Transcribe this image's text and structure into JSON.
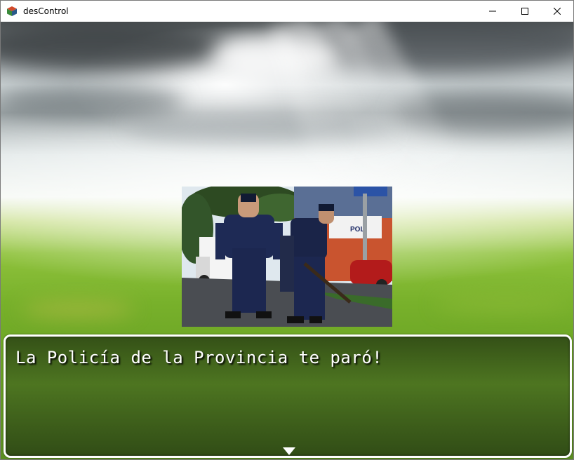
{
  "window": {
    "title": "desControl",
    "icon": "app-cube-icon",
    "controls": [
      "minimize-icon",
      "maximize-icon",
      "close-icon"
    ]
  },
  "scene": {
    "background": "cloudy sky over green grass field",
    "picture": "police officers standing in a street in front of a police station"
  },
  "dialog": {
    "message": "La Policía de la Provincia te paró!",
    "continue_indicator": "down-triangle-icon"
  },
  "colors": {
    "dialog_border": "#ffffff",
    "text": "#ffffff",
    "grass": "#78b12b",
    "uniform": "#1e2a55"
  }
}
